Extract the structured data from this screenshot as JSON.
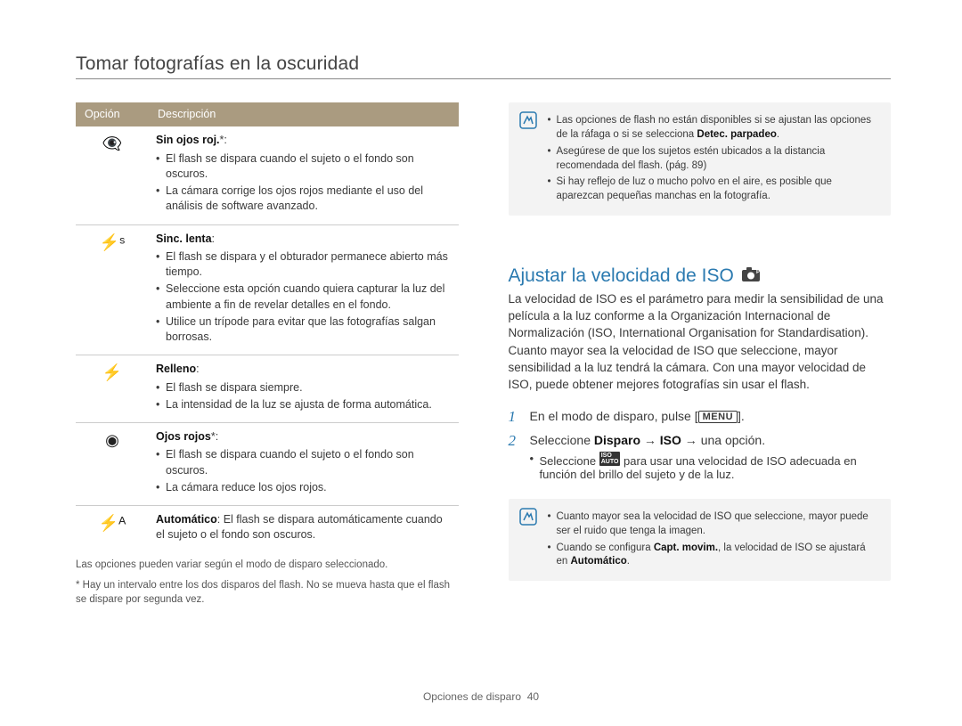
{
  "page_title": "Tomar fotografías en la oscuridad",
  "table": {
    "headers": {
      "col1": "Opción",
      "col2": "Descripción"
    },
    "rows": [
      {
        "icon": "👁️‍🗨️",
        "name": "Sin ojos roj.",
        "suffix": "*:",
        "bullets": [
          "El flash se dispara cuando el sujeto o el fondo son oscuros.",
          "La cámara corrige los ojos rojos mediante el uso del análisis de software avanzado."
        ]
      },
      {
        "icon": "⚡ˢ",
        "name": "Sinc. lenta",
        "suffix": ":",
        "bullets": [
          "El flash se dispara y el obturador permanece abierto más tiempo.",
          "Seleccione esta opción cuando quiera capturar la luz del ambiente a fin de revelar detalles en el fondo.",
          "Utilice un trípode para evitar que las fotografías salgan borrosas."
        ]
      },
      {
        "icon": "⚡",
        "name": "Relleno",
        "suffix": ":",
        "bullets": [
          "El flash se dispara siempre.",
          "La intensidad de la luz se ajusta de forma automática."
        ]
      },
      {
        "icon": "◉",
        "name": "Ojos rojos",
        "suffix": "*:",
        "bullets": [
          "El flash se dispara cuando el sujeto o el fondo son oscuros.",
          "La cámara reduce los ojos rojos."
        ]
      },
      {
        "icon": "⚡ᴬ",
        "name": "Automático",
        "suffix": ":",
        "inline": " El flash se dispara automáticamente cuando el sujeto o el fondo son oscuros."
      }
    ]
  },
  "footnotes": [
    "Las opciones pueden variar según el modo de disparo seleccionado.",
    "* Hay un intervalo entre los dos disparos del flash. No se mueva hasta que el flash se dispare por segunda vez."
  ],
  "notebox1": {
    "items": [
      {
        "pre": "Las opciones de flash no están disponibles si se ajustan las opciones de la ráfaga o si se selecciona ",
        "strong": "Detec. parpadeo",
        "post": "."
      },
      {
        "text": "Asegúrese de que los sujetos estén ubicados a la distancia recomendada del flash. (pág. 89)"
      },
      {
        "text": "Si hay reflejo de luz o mucho polvo en el aire, es posible que aparezcan pequeñas manchas en la fotografía."
      }
    ]
  },
  "section": {
    "heading": "Ajustar la velocidad de ISO",
    "body": "La velocidad de ISO es el parámetro para medir la sensibilidad de una película a la luz conforme a la Organización Internacional de Normalización (ISO, International Organisation for Standardisation). Cuanto mayor sea la velocidad de ISO que seleccione, mayor sensibilidad a la luz tendrá la cámara. Con una mayor velocidad de ISO, puede obtener mejores fotografías sin usar el flash.",
    "steps": {
      "s1": {
        "a": "En el modo de disparo, pulse [",
        "b": "MENU",
        "c": "]."
      },
      "s2": {
        "a": "Seleccione ",
        "b": "Disparo",
        "c": " → ",
        "d": "ISO",
        "e": " → una opción."
      },
      "s2sub": {
        "pre": "Seleccione ",
        "icon": "ISOᴬᵁᵀᴼ",
        "post": " para usar una velocidad de ISO adecuada en función del brillo del sujeto y de la luz."
      }
    }
  },
  "notebox2": {
    "items": [
      {
        "text": "Cuanto mayor sea la velocidad de ISO que seleccione, mayor puede ser el ruido que tenga la imagen."
      },
      {
        "pre": "Cuando se configura ",
        "strong": "Capt. movim.",
        "mid": ", la velocidad de ISO se ajustará en ",
        "strong2": "Automático",
        "post": "."
      }
    ]
  },
  "footer": {
    "label": "Opciones de disparo",
    "page": "40"
  }
}
